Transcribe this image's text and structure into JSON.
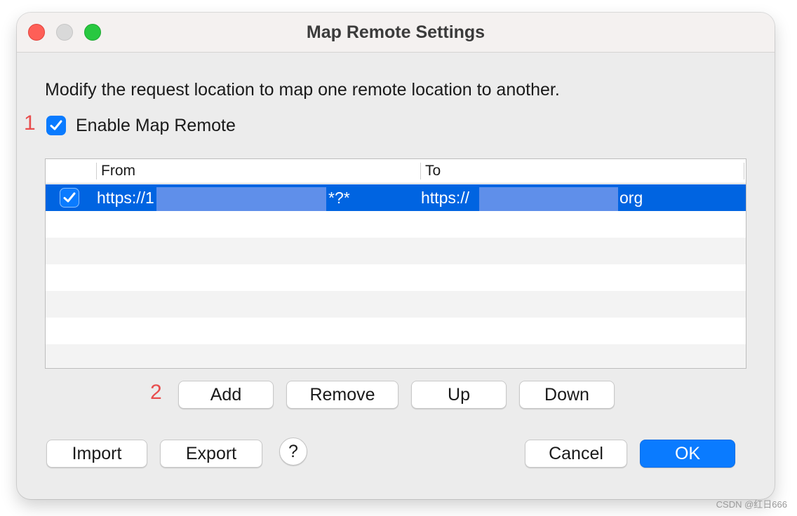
{
  "window": {
    "title": "Map Remote Settings"
  },
  "description": "Modify the request location to map one remote location to another.",
  "annotations": {
    "marker_1": "1",
    "marker_2": "2"
  },
  "enable": {
    "label": "Enable Map Remote",
    "checked": true
  },
  "table": {
    "columns": [
      "From",
      "To"
    ],
    "rows": [
      {
        "enabled": true,
        "from_prefix": "https://1",
        "from_suffix": "*?*",
        "to_prefix": "https://",
        "to_suffix": "org",
        "selected": true
      }
    ]
  },
  "buttons": {
    "add": "Add",
    "remove": "Remove",
    "up": "Up",
    "down": "Down",
    "import": "Import",
    "export": "Export",
    "help": "?",
    "cancel": "Cancel",
    "ok": "OK"
  },
  "colors": {
    "accent": "#0a7bff",
    "selection": "#0064e1",
    "annotation_red": "#e84d4d"
  },
  "watermark": "CSDN @红日666"
}
